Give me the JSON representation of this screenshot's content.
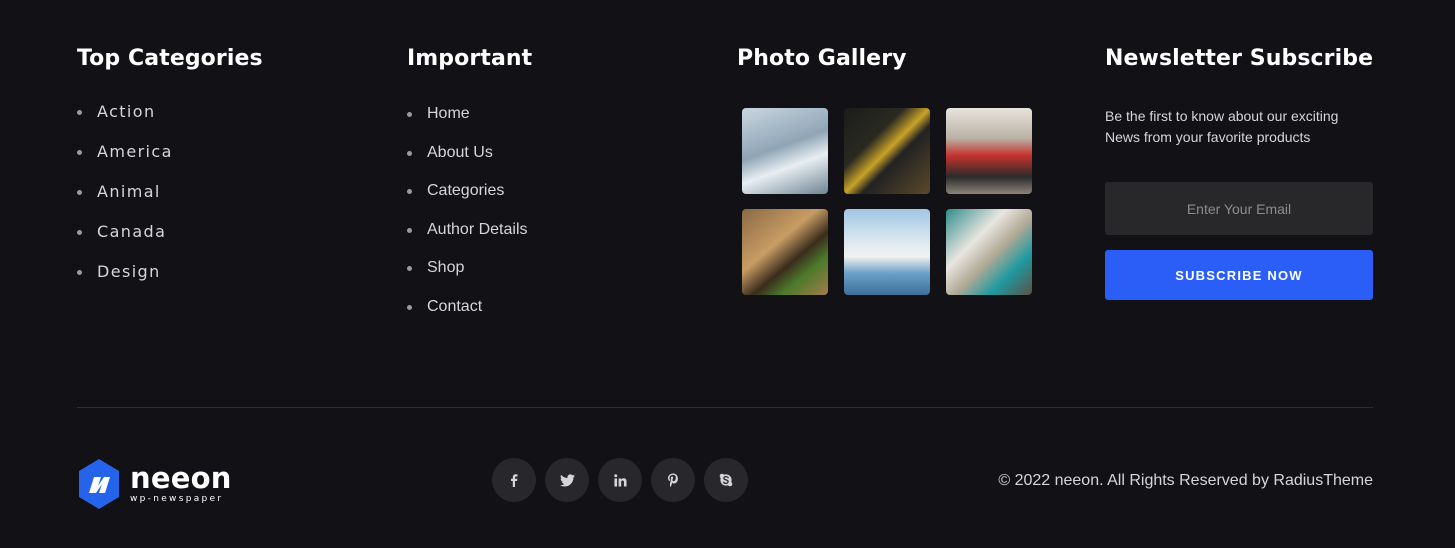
{
  "top_categories": {
    "title": "Top Categories",
    "items": [
      "Action",
      "America",
      "Animal",
      "Canada",
      "Design"
    ]
  },
  "important": {
    "title": "Important",
    "items": [
      "Home",
      "About Us",
      "Categories",
      "Author Details",
      "Shop",
      "Contact"
    ]
  },
  "gallery": {
    "title": "Photo Gallery",
    "photos": [
      "surfer",
      "soccer-player",
      "cyclists",
      "motocross",
      "santorini",
      "pool-lounge"
    ]
  },
  "newsletter": {
    "title": "Newsletter Subscribe",
    "text": "Be the first to know about our exciting News from your favorite products",
    "email_placeholder": "Enter Your Email",
    "button_label": "SUBSCRIBE NOW"
  },
  "footer": {
    "logo_name": "neeon",
    "logo_tagline": "wp-newspaper",
    "social_icons": [
      "facebook-icon",
      "twitter-icon",
      "linkedin-icon",
      "pinterest-icon",
      "skype-icon"
    ],
    "copyright": "© 2022 neeon. All Rights Reserved by RadiusTheme"
  },
  "colors": {
    "background": "#111116",
    "accent": "#2a5ef7",
    "logo_blue": "#2563eb"
  }
}
